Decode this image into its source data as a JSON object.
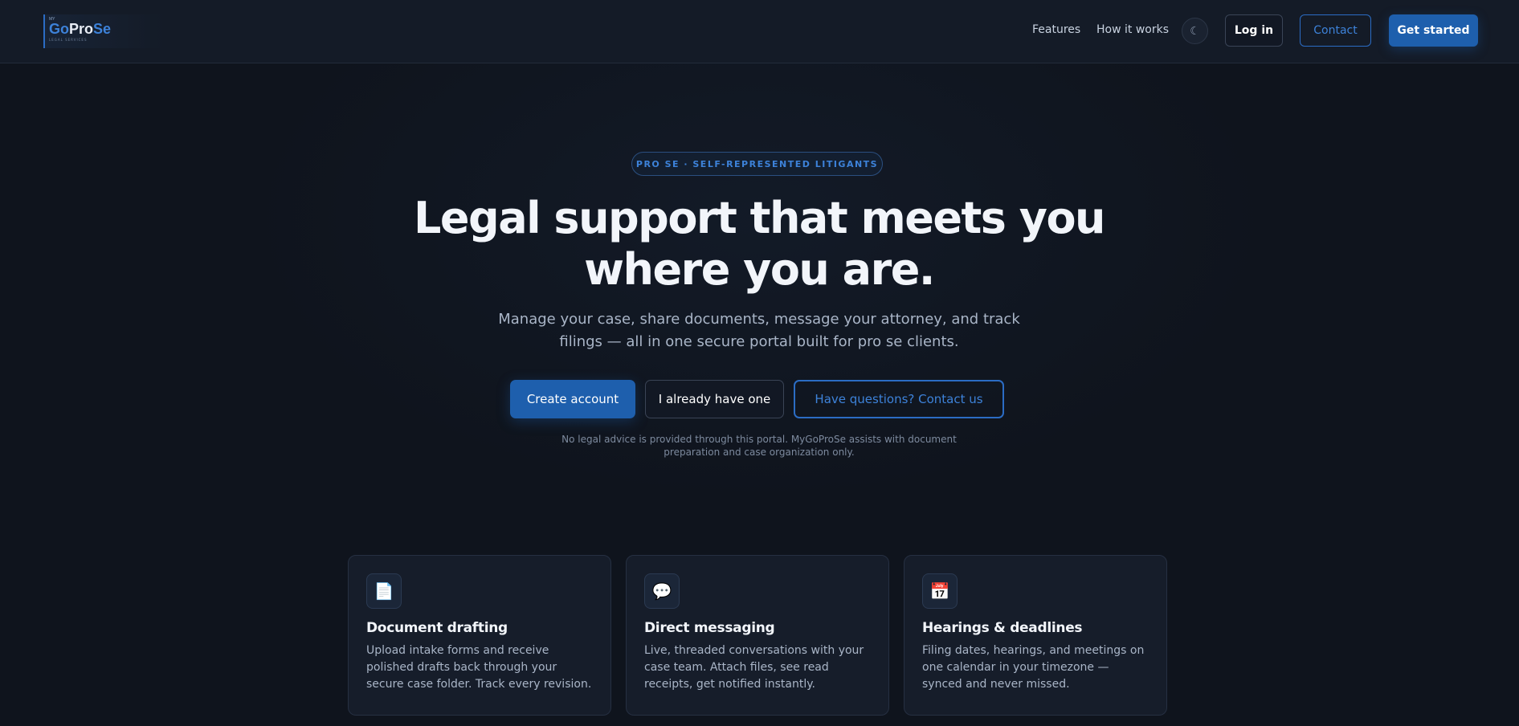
{
  "header": {
    "logo": {
      "my": "MY",
      "go": "Go",
      "pro": "Pro",
      "se": "Se",
      "sub": "LEGAL SERVICES"
    },
    "nav": [
      "Features",
      "How it works"
    ],
    "theme_icon": "☾",
    "login_label": "Log in",
    "contact_label": "Contact",
    "get_started_label": "Get started"
  },
  "hero": {
    "badge": "PRO SE · SELF-REPRESENTED LITIGANTS",
    "title_line1": "Legal support that meets you",
    "title_line2": "where you are.",
    "subtitle": "Manage your case, share documents, message your attorney, and track filings — all in one secure portal built for pro se clients.",
    "create_label": "Create account",
    "have_label": "I already have one",
    "questions_label": "Have questions? Contact us",
    "disclaimer": "No legal advice is provided through this portal. MyGoProSe assists with document preparation and case organization only."
  },
  "features": [
    {
      "icon": "📄",
      "icon_name": "document-icon",
      "title": "Document drafting",
      "desc": "Upload intake forms and receive polished drafts back through your secure case folder. Track every revision."
    },
    {
      "icon": "💬",
      "icon_name": "speech-bubble-icon",
      "title": "Direct messaging",
      "desc": "Live, threaded conversations with your case team. Attach files, see read receipts, get notified instantly."
    },
    {
      "icon": "📅",
      "icon_name": "calendar-icon",
      "title": "Hearings & deadlines",
      "desc": "Filing dates, hearings, and meetings on one calendar in your timezone — synced and never missed."
    }
  ],
  "colors": {
    "background": "#0f141d",
    "header_bg": "#141b27",
    "accent": "#1e5fad",
    "accent_text": "#3d82d9",
    "card_bg": "#161d2a"
  }
}
